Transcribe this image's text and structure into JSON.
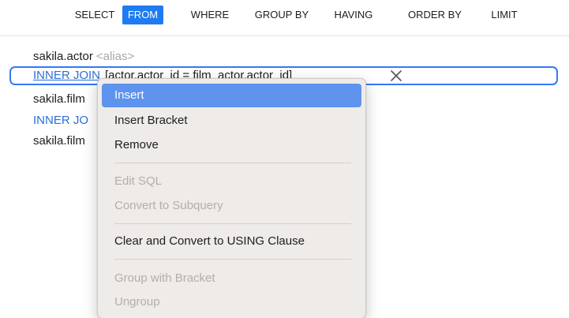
{
  "clause_tabs": [
    {
      "label": "SELECT",
      "active": false
    },
    {
      "label": "FROM",
      "active": true
    },
    {
      "label": "WHERE",
      "active": false
    },
    {
      "label": "GROUP BY",
      "active": false
    },
    {
      "label": "HAVING",
      "active": false
    },
    {
      "label": "ORDER BY",
      "active": false
    },
    {
      "label": "LIMIT",
      "active": false
    }
  ],
  "from_clause": {
    "rows": [
      {
        "type": "table",
        "name": "sakila.actor",
        "alias_placeholder": "<alias>"
      },
      {
        "type": "join",
        "keyword": "INNER JOIN",
        "condition": "[actor.actor_id = film_actor.actor_id]",
        "selected": true
      },
      {
        "type": "table",
        "name": "sakila.film_actor"
      },
      {
        "type": "join",
        "keyword": "INNER JOIN"
      },
      {
        "type": "table",
        "name": "sakila.film"
      }
    ],
    "visible_text": {
      "row1_name": "sakila.actor",
      "row1_alias": "<alias>",
      "row2_keyword": "INNER JOIN",
      "row2_condition": "[actor.actor_id = film_actor.actor_id]",
      "row3_name": "sakila.film",
      "row4_keyword": "INNER JO",
      "row5_name": "sakila.film"
    }
  },
  "remove_icon": "close-icon",
  "context_menu": {
    "items": [
      {
        "label": "Insert",
        "enabled": true,
        "highlighted": true
      },
      {
        "label": "Insert Bracket",
        "enabled": true
      },
      {
        "label": "Remove",
        "enabled": true
      },
      {
        "label": "Edit SQL",
        "enabled": false
      },
      {
        "label": "Convert to Subquery",
        "enabled": false
      },
      {
        "label": "Clear and Convert to USING Clause",
        "enabled": true
      },
      {
        "label": "Group with Bracket",
        "enabled": false
      },
      {
        "label": "Ungroup",
        "enabled": false
      }
    ]
  },
  "colors": {
    "accent": "#1f7bf2",
    "join_keyword": "#2a6fd6",
    "menu_highlight": "#5e93ee",
    "selection_border": "#3478f6"
  }
}
